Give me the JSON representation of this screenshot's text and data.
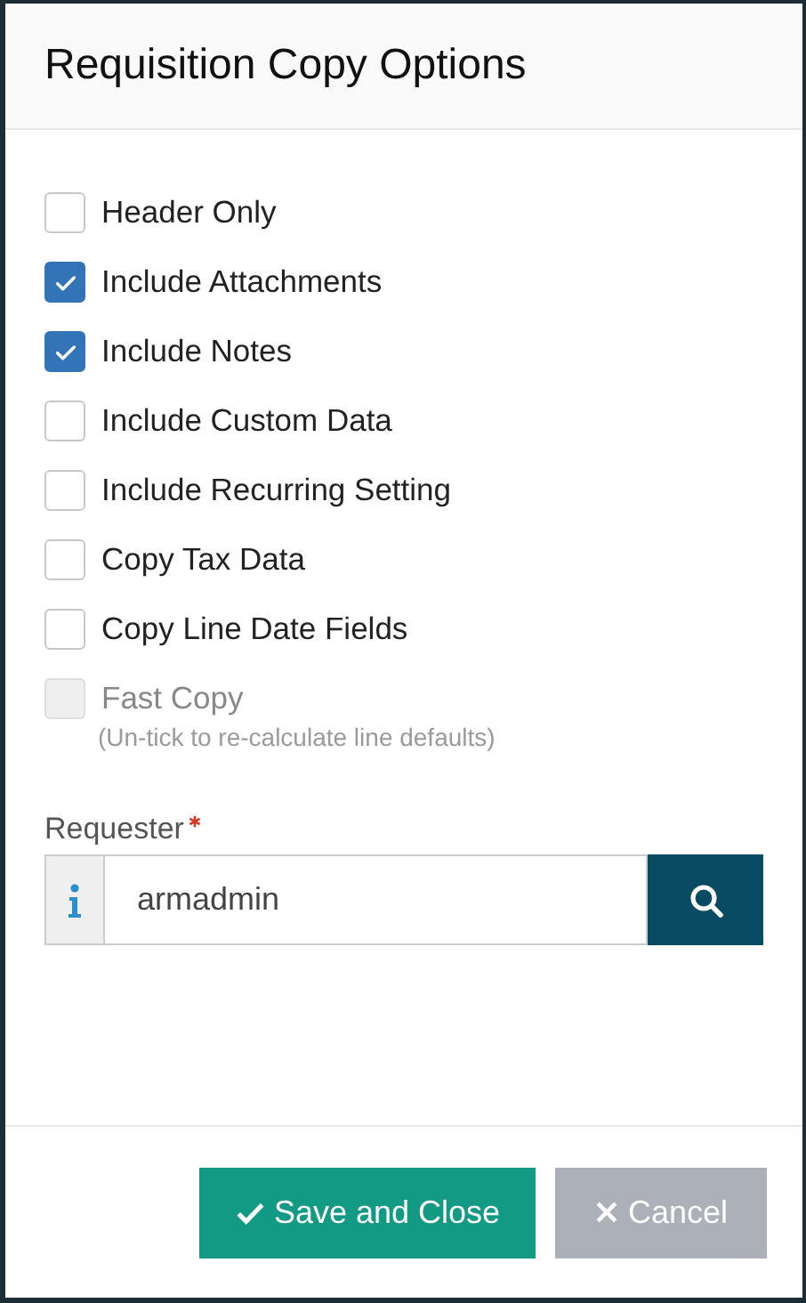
{
  "dialog": {
    "title": "Requisition Copy Options"
  },
  "options": [
    {
      "label": "Header Only",
      "checked": false,
      "disabled": false
    },
    {
      "label": "Include Attachments",
      "checked": true,
      "disabled": false
    },
    {
      "label": "Include Notes",
      "checked": true,
      "disabled": false
    },
    {
      "label": "Include Custom Data",
      "checked": false,
      "disabled": false
    },
    {
      "label": "Include Recurring Setting",
      "checked": false,
      "disabled": false
    },
    {
      "label": "Copy Tax Data",
      "checked": false,
      "disabled": false
    },
    {
      "label": "Copy Line Date Fields",
      "checked": false,
      "disabled": false
    },
    {
      "label": "Fast Copy",
      "checked": false,
      "disabled": true,
      "hint": "(Un-tick to re-calculate line defaults)"
    }
  ],
  "requester": {
    "label": "Requester",
    "required": true,
    "value": "armadmin"
  },
  "buttons": [
    {
      "label": "Save and Close",
      "kind": "primary"
    },
    {
      "label": "Cancel",
      "kind": "secondary"
    }
  ]
}
